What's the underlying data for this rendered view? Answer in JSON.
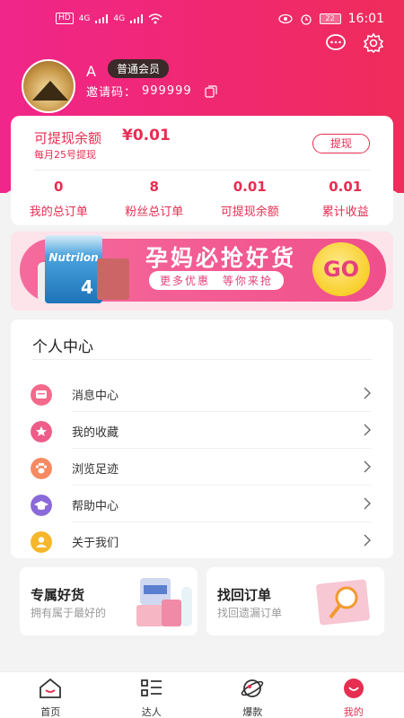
{
  "colors": {
    "accent": "#e62e52",
    "header": "#f0286e"
  },
  "statusbar": {
    "network": "HD",
    "signal_a": "4G",
    "signal_b": "4G",
    "battery": "22",
    "time": "16:01"
  },
  "profile": {
    "name": "A",
    "member_level": "普通会员",
    "invite_label": "邀请码：",
    "invite_code": "999999"
  },
  "wallet": {
    "label": "可提现余额",
    "amount": "¥0.01",
    "note": "每月25号提现",
    "withdraw_button": "提现",
    "stats": [
      {
        "value": "0",
        "label": "我的总订单"
      },
      {
        "value": "8",
        "label": "粉丝总订单"
      },
      {
        "value": "0.01",
        "label": "可提现余额"
      },
      {
        "value": "0.01",
        "label": "累计收益"
      }
    ]
  },
  "banner": {
    "title": "孕妈必抢好货",
    "subtitle": "更多优惠　等你来抢",
    "go": "GO",
    "product": "Nutrilon",
    "product_num": "4"
  },
  "personal_center": {
    "title": "个人中心",
    "items": [
      {
        "label": "消息中心",
        "icon": "message-icon",
        "color": "#f36a8c"
      },
      {
        "label": "我的收藏",
        "icon": "favorite-icon",
        "color": "#ee5c8a"
      },
      {
        "label": "浏览足迹",
        "icon": "footprint-icon",
        "color": "#f58a62"
      },
      {
        "label": "帮助中心",
        "icon": "help-icon",
        "color": "#8a6ad8"
      },
      {
        "label": "关于我们",
        "icon": "about-icon",
        "color": "#f5b62a"
      }
    ]
  },
  "promos": [
    {
      "title": "专属好货",
      "subtitle": "拥有属于最好的"
    },
    {
      "title": "找回订单",
      "subtitle": "找回遗漏订单"
    }
  ],
  "tabbar": [
    {
      "label": "首页",
      "icon": "home-icon"
    },
    {
      "label": "达人",
      "icon": "list-icon"
    },
    {
      "label": "爆款",
      "icon": "planet-icon"
    },
    {
      "label": "我的",
      "icon": "profile-icon"
    }
  ]
}
